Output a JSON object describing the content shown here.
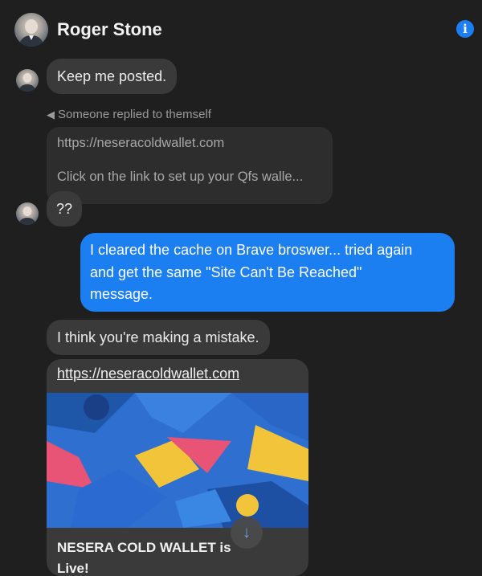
{
  "header": {
    "contact_name": "Roger Stone",
    "info_icon": "info-icon"
  },
  "messages": {
    "m1": "Keep me posted.",
    "reply_label": "Someone replied to themself",
    "quoted_url": "https://neseracoldwallet.com",
    "quoted_text": "Click on the link to set up your Qfs walle...",
    "m2": "??",
    "m3_line1": "I cleared the cache on Brave broswer... tried again",
    "m3_line2": "and get the same \"Site Can't Be Reached\"",
    "m3_line3": "message.",
    "m4": "I think you're making a mistake.",
    "link_url": "https://neseracoldwallet.com",
    "link_title_line1": "NESERA COLD WALLET  is",
    "link_title_line2": "Live!"
  },
  "colors": {
    "outgoing": "#1b7ff2",
    "incoming": "#3a3a3a",
    "background": "#1f1f1f",
    "accent": "#1c7ef0"
  }
}
